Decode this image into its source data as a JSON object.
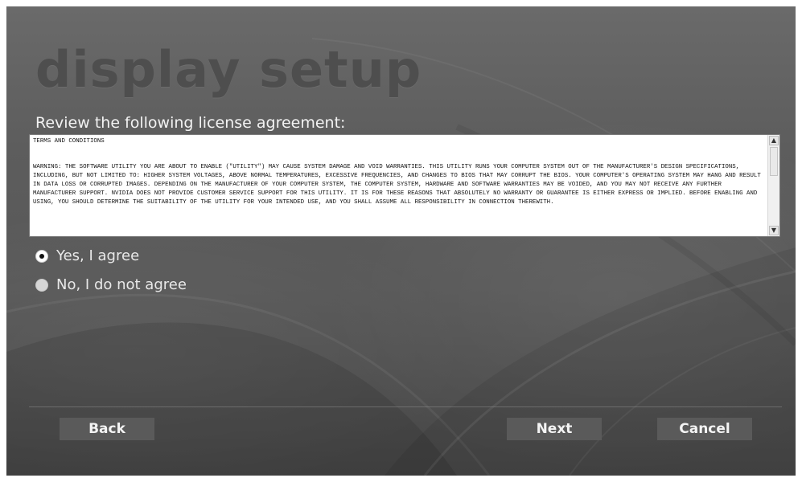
{
  "header": {
    "title": "display setup",
    "subtitle": "Review the following license agreement:"
  },
  "license": {
    "text": "TERMS AND CONDITIONS\n\n\nWARNING: THE SOFTWARE UTILITY YOU ARE ABOUT TO ENABLE (\"UTILITY\") MAY CAUSE SYSTEM DAMAGE AND VOID WARRANTIES. THIS UTILITY RUNS YOUR COMPUTER SYSTEM OUT OF THE MANUFACTURER'S DESIGN SPECIFICATIONS, INCLUDING, BUT NOT LIMITED TO: HIGHER SYSTEM VOLTAGES, ABOVE NORMAL TEMPERATURES, EXCESSIVE FREQUENCIES, AND CHANGES TO BIOS THAT MAY CORRUPT THE BIOS. YOUR COMPUTER'S OPERATING SYSTEM MAY HANG AND RESULT IN DATA LOSS OR CORRUPTED IMAGES. DEPENDING ON THE MANUFACTURER OF YOUR COMPUTER SYSTEM, THE COMPUTER SYSTEM, HARDWARE AND SOFTWARE WARRANTIES MAY BE VOIDED, AND YOU MAY NOT RECEIVE ANY FURTHER MANUFACTURER SUPPORT. NVIDIA DOES NOT PROVIDE CUSTOMER SERVICE SUPPORT FOR THIS UTILITY. IT IS FOR THESE REASONS THAT ABSOLUTELY NO WARRANTY OR GUARANTEE IS EITHER EXPRESS OR IMPLIED. BEFORE ENABLING AND USING, YOU SHOULD DETERMINE THE SUITABILITY OF THE UTILITY FOR YOUR INTENDED USE, AND YOU SHALL ASSUME ALL RESPONSIBILITY IN CONNECTION THEREWITH.",
    "scroll_up_icon": "▲",
    "scroll_down_icon": "▼"
  },
  "agreement": {
    "options": [
      {
        "label": "Yes, I agree",
        "selected": true
      },
      {
        "label": "No, I do not agree",
        "selected": false
      }
    ]
  },
  "footer": {
    "back_label": "Back",
    "next_label": "Next",
    "cancel_label": "Cancel"
  },
  "colors": {
    "background": "#5d5d5d",
    "title": "#4e4e4e",
    "button": "#5a5a5a",
    "text_light": "#f2f2f2"
  }
}
